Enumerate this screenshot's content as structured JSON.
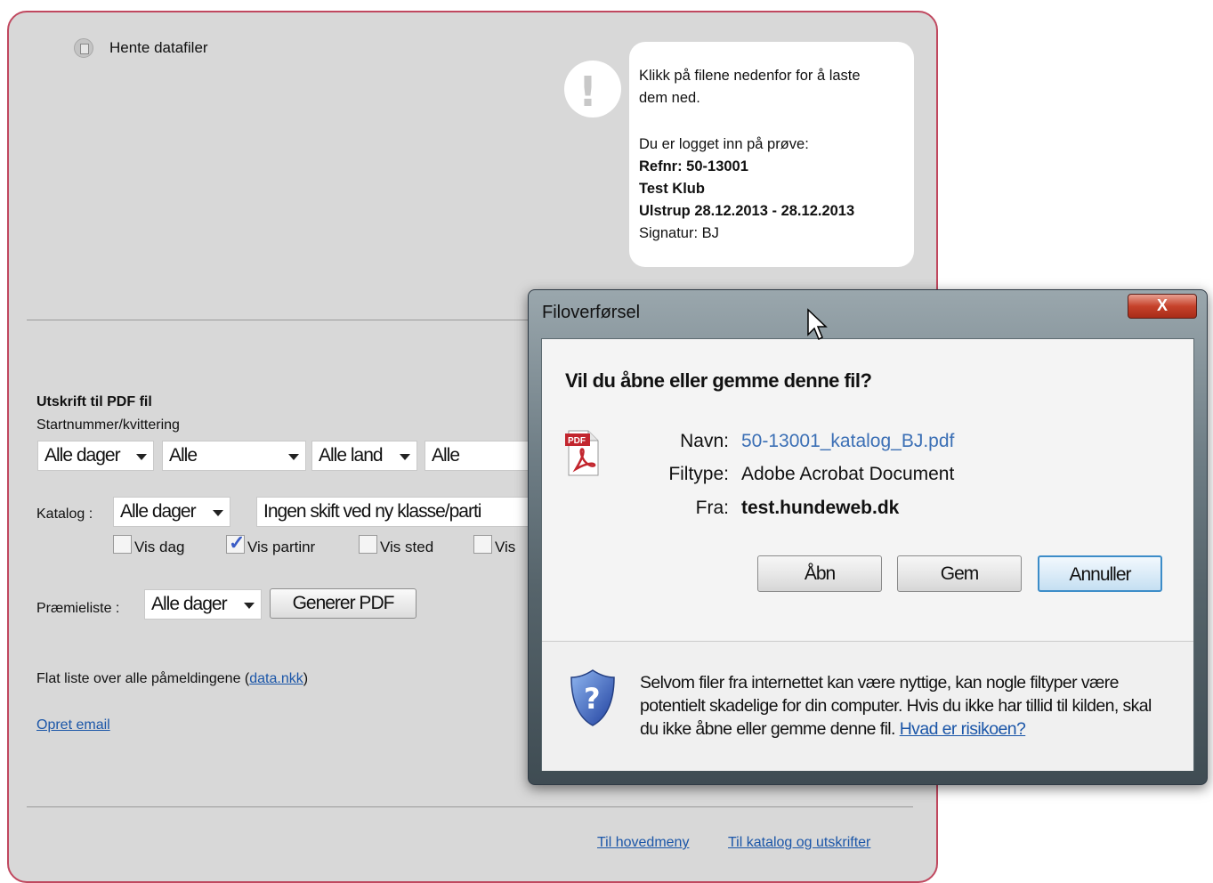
{
  "header": {
    "title": "Hente datafiler",
    "icon": "document-icon"
  },
  "info_bubble": {
    "line1": "Klikk på filene nedenfor for å laste",
    "line2": "dem ned.",
    "line3": "Du er logget inn på prøve:",
    "refnr": "Refnr: 50-13001",
    "club": "Test Klub",
    "place": "Ulstrup 28.12.2013 - 28.12.2013",
    "signature": "Signatur: BJ",
    "icon": "exclamation-icon"
  },
  "pdf_section": {
    "heading": "Utskrift til PDF fil",
    "subheading": "Startnummer/kvittering",
    "start_selects": [
      "Alle dager",
      "Alle",
      "Alle land",
      "Alle"
    ],
    "katalog_label": "Katalog :",
    "katalog_day": "Alle dager",
    "katalog_option": "Ingen skift ved ny klasse/parti",
    "checkboxes": [
      {
        "label": "Vis dag",
        "checked": false
      },
      {
        "label": "Vis partinr",
        "checked": true
      },
      {
        "label": "Vis sted",
        "checked": false
      },
      {
        "label": "Vis",
        "checked": false
      }
    ],
    "premieliste_label": "Præmieliste :",
    "premieliste_day": "Alle dager",
    "generate_button": "Generer PDF"
  },
  "flat_list": {
    "text": "Flat liste over alle påmeldingene (",
    "link": "data.nkk",
    "close": ")"
  },
  "opret_email": "Opret email",
  "footer": {
    "link1": "Til hovedmeny",
    "link2": "Til katalog og utskrifter"
  },
  "dialog": {
    "title": "Filoverførsel",
    "close": "X",
    "question": "Vil du åbne eller gemme denne fil?",
    "name_label": "Navn:",
    "name_value": "50-13001_katalog_BJ.pdf",
    "type_label": "Filtype:",
    "type_value": "Adobe Acrobat Document",
    "from_label": "Fra:",
    "from_value": "test.hundeweb.dk",
    "btn_open": "Åbn",
    "btn_save": "Gem",
    "btn_cancel": "Annuller",
    "warning": "Selvom filer fra internettet kan være nyttige, kan nogle filtyper være potentielt skadelige for din computer. Hvis du ikke har tillid til kilden, skal du ikke åbne eller gemme denne fil.",
    "risk_link": "Hvad er risikoen?",
    "file_icon": "pdf-icon",
    "shield_icon": "security-shield-icon"
  },
  "colors": {
    "panel_border": "#c0485f",
    "link": "#1b56a8",
    "panel_bg": "#d8d8d8"
  }
}
